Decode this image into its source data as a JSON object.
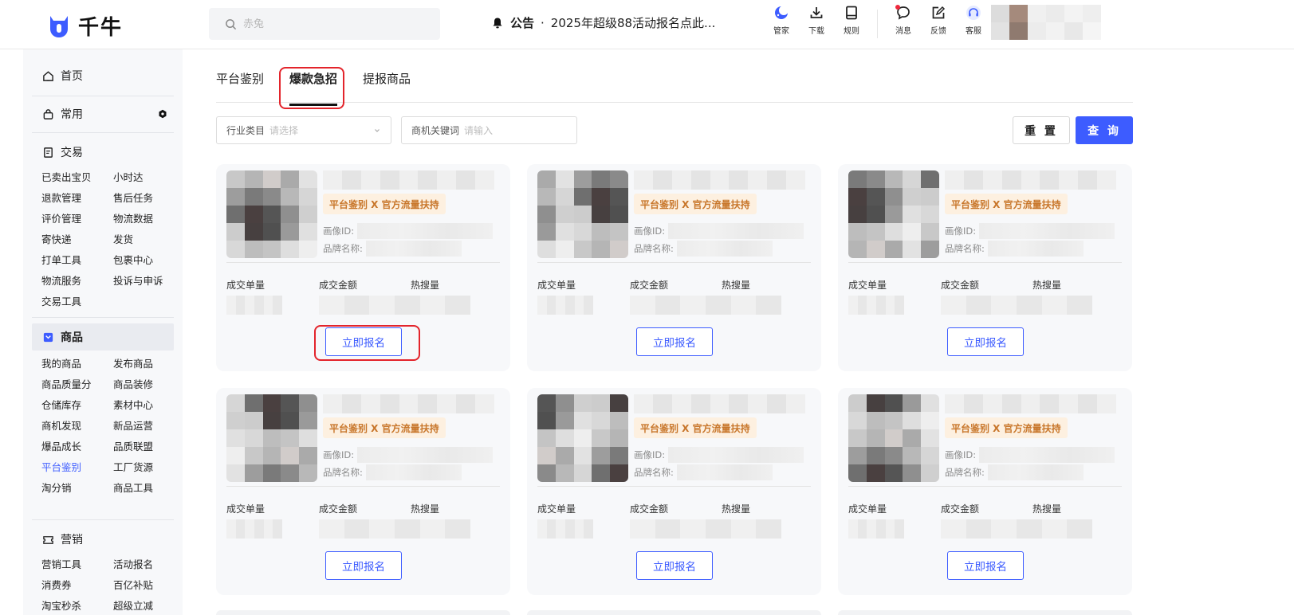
{
  "header": {
    "logo_text": "千牛",
    "search_placeholder": "赤兔",
    "notice_label": "公告",
    "notice_dot": "·",
    "notice_text": "2025年超级88活动报名点此...",
    "tools": [
      {
        "label": "管家",
        "icon": "moon-icon"
      },
      {
        "label": "下载",
        "icon": "download-icon"
      },
      {
        "label": "规则",
        "icon": "book-icon"
      },
      {
        "label": "消息",
        "icon": "chat-icon"
      },
      {
        "label": "反馈",
        "icon": "edit-icon"
      },
      {
        "label": "客服",
        "icon": "headset-icon"
      }
    ]
  },
  "sidebar": {
    "home": "首页",
    "common": "常用",
    "trade": {
      "title": "交易",
      "items": [
        "已卖出宝贝",
        "小时达",
        "退款管理",
        "售后任务",
        "评价管理",
        "物流数据",
        "寄快递",
        "发货",
        "打单工具",
        "包裹中心",
        "物流服务",
        "投诉与申诉",
        "交易工具"
      ]
    },
    "goods": {
      "title": "商品",
      "items": [
        "我的商品",
        "发布商品",
        "商品质量分",
        "商品装修",
        "仓储库存",
        "素材中心",
        "商机发现",
        "新品运营",
        "爆品成长",
        "品质联盟",
        "平台鉴别",
        "工厂货源",
        "淘分销",
        "商品工具"
      ],
      "current": "平台鉴别"
    },
    "marketing": {
      "title": "营销",
      "items": [
        "营销工具",
        "活动报名",
        "消费券",
        "百亿补贴",
        "淘宝秒杀",
        "超级立减"
      ]
    }
  },
  "main": {
    "tabs": [
      "平台鉴别",
      "爆款急招",
      "提报商品"
    ],
    "active_tab": "爆款急招",
    "filters": {
      "industry_label": "行业类目",
      "industry_placeholder": "请选择",
      "keyword_label": "商机关键词",
      "keyword_placeholder": "请输入"
    },
    "reset_label": "重 置",
    "query_label": "查 询",
    "cards": {
      "badge": "平台鉴别 X 官方流量扶持",
      "portrait_id_label": "画像ID:",
      "brand_label": "品牌名称:",
      "stat_orders": "成交单量",
      "stat_amount": "成交金额",
      "stat_search": "热搜量",
      "apply_label": "立即报名"
    }
  },
  "colors": {
    "accent": "#3d5cff",
    "badge_bg": "#fdf0e0",
    "badge_text": "#c8762a",
    "highlight": "#e3242b"
  }
}
